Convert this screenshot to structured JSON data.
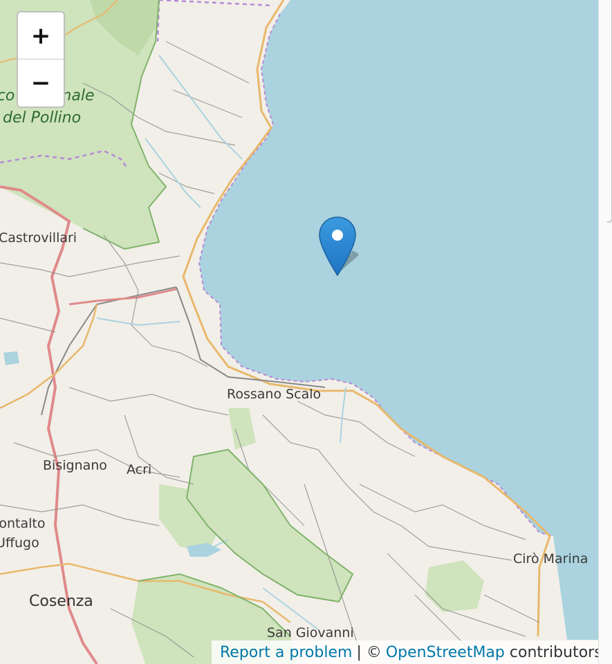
{
  "map": {
    "zoom_in_label": "+",
    "zoom_out_label": "−",
    "labels": {
      "park_line1": "Parco Nazionale",
      "park_line2": "del Pollino",
      "castrovillari": "Castrovillari",
      "rossano": "Rossano Scalo",
      "bisignano": "Bisignano",
      "acri": "Acri",
      "montalto_line1": "Montalto",
      "montalto_line2": "Uffugo",
      "cosenza": "Cosenza",
      "ciro": "Cirò Marina",
      "sangiovanni": "San Giovanni"
    },
    "marker": {
      "icon": "location-pin-icon",
      "color": "#2a86d4"
    },
    "colors": {
      "sea": "#aad3df",
      "land": "#f2efe9",
      "forest": "#c8dfb5",
      "boundary": "#b58ad6",
      "main_road": "#e08a8a"
    }
  },
  "attribution": {
    "report": "Report a problem",
    "separator": "| ©",
    "osm": "OpenStreetMap",
    "contributors": "contributors"
  }
}
